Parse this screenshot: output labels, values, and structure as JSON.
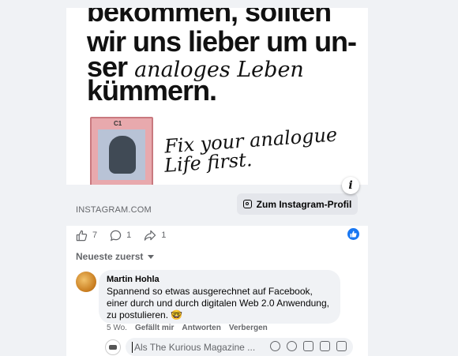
{
  "post": {
    "hero": {
      "line1": "bekommen, sollten",
      "line2": "wir uns lieber um un-",
      "line3_bold": "ser",
      "line3_script": "analoges Leben",
      "line4": "kümmern.",
      "script_line1": "Fix your analogue",
      "script_line2": "Life first.",
      "card_caption": "gorilla",
      "card_tag": "C1"
    },
    "link": {
      "domain": "INSTAGRAM.COM",
      "button_label": "Zum Instagram-Profil"
    },
    "reactions": {
      "likes": "7",
      "comments": "1",
      "shares": "1"
    }
  },
  "comments": {
    "sort_label": "Neueste zuerst",
    "items": [
      {
        "author": "Martin Hohla",
        "text": "Spannend so etwas ausgerechnet auf Facebook, einer durch und durch digitalen Web 2.0 Anwendung, zu postulieren. 🤓",
        "time": "5 Wo.",
        "like_action": "Gefällt mir",
        "reply_action": "Antworten",
        "hide_action": "Verbergen"
      }
    ],
    "reply_placeholder": "Als The Kurious Magazine ..."
  },
  "icons": {
    "like": "thumbs-up-icon",
    "comment": "comment-bubble-icon",
    "share": "share-arrow-icon",
    "info": "info-icon",
    "instagram": "instagram-icon"
  },
  "colors": {
    "accent": "#1877f2",
    "background": "#f0f2f5",
    "muted_text": "#65676b"
  }
}
